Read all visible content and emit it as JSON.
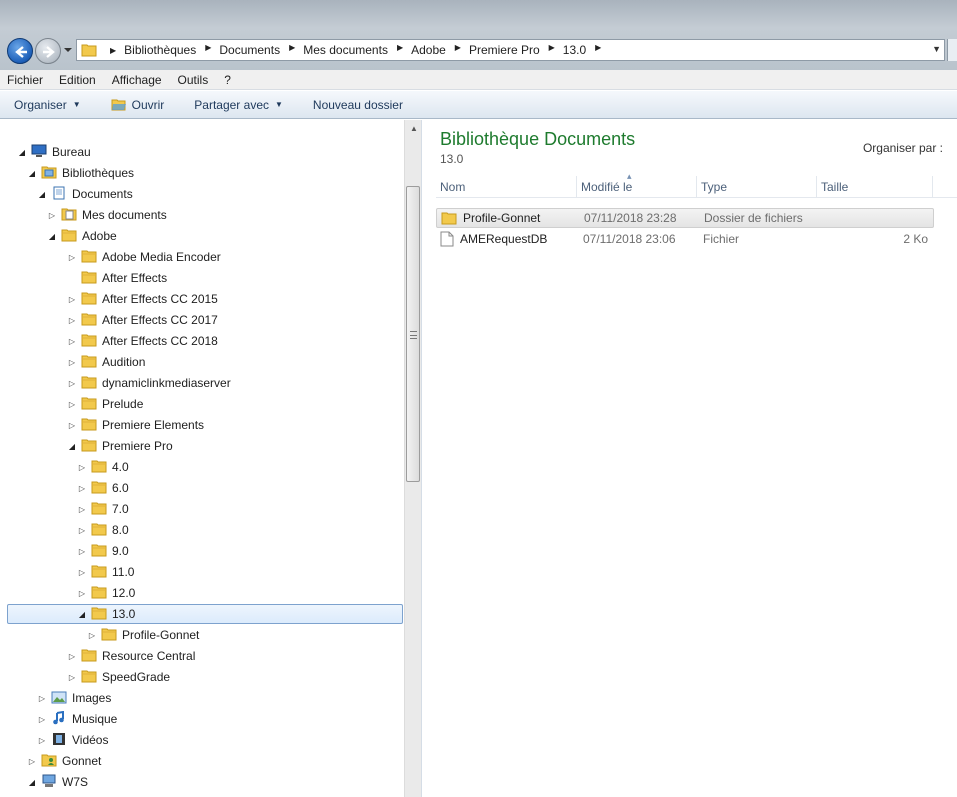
{
  "address": {
    "crumbs": [
      "Bibliothèques",
      "Documents",
      "Mes documents",
      "Adobe",
      "Premiere Pro",
      "13.0"
    ]
  },
  "menu": [
    "Fichier",
    "Edition",
    "Affichage",
    "Outils",
    "?"
  ],
  "commands": {
    "organize": "Organiser",
    "open": "Ouvrir",
    "share": "Partager avec",
    "new_folder": "Nouveau dossier"
  },
  "tree": [
    {
      "label": "Bureau",
      "level": 0,
      "expander": "open",
      "icon": "desktop"
    },
    {
      "label": "Bibliothèques",
      "level": 1,
      "expander": "open",
      "icon": "libraries"
    },
    {
      "label": "Documents",
      "level": 2,
      "expander": "open",
      "icon": "documents"
    },
    {
      "label": "Mes documents",
      "level": 3,
      "expander": "closed",
      "icon": "mydocs"
    },
    {
      "label": "Adobe",
      "level": 3,
      "expander": "open",
      "icon": "folder"
    },
    {
      "label": "Adobe Media Encoder",
      "level": 4,
      "expander": "closed",
      "icon": "folder"
    },
    {
      "label": "After Effects",
      "level": 4,
      "expander": "none",
      "icon": "folder"
    },
    {
      "label": "After Effects CC 2015",
      "level": 4,
      "expander": "closed",
      "icon": "folder"
    },
    {
      "label": "After Effects CC 2017",
      "level": 4,
      "expander": "closed",
      "icon": "folder"
    },
    {
      "label": "After Effects CC 2018",
      "level": 4,
      "expander": "closed",
      "icon": "folder"
    },
    {
      "label": "Audition",
      "level": 4,
      "expander": "closed",
      "icon": "folder"
    },
    {
      "label": "dynamiclinkmediaserver",
      "level": 4,
      "expander": "closed",
      "icon": "folder"
    },
    {
      "label": "Prelude",
      "level": 4,
      "expander": "closed",
      "icon": "folder"
    },
    {
      "label": "Premiere Elements",
      "level": 4,
      "expander": "closed",
      "icon": "folder"
    },
    {
      "label": "Premiere Pro",
      "level": 4,
      "expander": "open",
      "icon": "folder"
    },
    {
      "label": "4.0",
      "level": 5,
      "expander": "closed",
      "icon": "folder"
    },
    {
      "label": "6.0",
      "level": 5,
      "expander": "closed",
      "icon": "folder"
    },
    {
      "label": "7.0",
      "level": 5,
      "expander": "closed",
      "icon": "folder"
    },
    {
      "label": "8.0",
      "level": 5,
      "expander": "closed",
      "icon": "folder"
    },
    {
      "label": "9.0",
      "level": 5,
      "expander": "closed",
      "icon": "folder"
    },
    {
      "label": "11.0",
      "level": 5,
      "expander": "closed",
      "icon": "folder"
    },
    {
      "label": "12.0",
      "level": 5,
      "expander": "closed",
      "icon": "folder"
    },
    {
      "label": "13.0",
      "level": 5,
      "expander": "open",
      "icon": "folder",
      "selected": true
    },
    {
      "label": "Profile-Gonnet",
      "level": 6,
      "expander": "closed",
      "icon": "folder"
    },
    {
      "label": "Resource Central",
      "level": 4,
      "expander": "closed",
      "icon": "folder"
    },
    {
      "label": "SpeedGrade",
      "level": 4,
      "expander": "closed",
      "icon": "folder"
    },
    {
      "label": "Images",
      "level": 2,
      "expander": "closed",
      "icon": "images"
    },
    {
      "label": "Musique",
      "level": 2,
      "expander": "closed",
      "icon": "music"
    },
    {
      "label": "Vidéos",
      "level": 2,
      "expander": "closed",
      "icon": "videos"
    },
    {
      "label": "Gonnet",
      "level": 1,
      "expander": "closed",
      "icon": "user"
    },
    {
      "label": "W7S",
      "level": 1,
      "expander": "open",
      "icon": "computer"
    }
  ],
  "content": {
    "title": "Bibliothèque Documents",
    "subtitle": "13.0",
    "arrange_label": "Organiser par :",
    "columns": [
      "Nom",
      "Modifié le",
      "Type",
      "Taille"
    ],
    "rows": [
      {
        "name": "Profile-Gonnet",
        "date": "07/11/2018 23:28",
        "type": "Dossier de fichiers",
        "size": "",
        "icon": "folder"
      },
      {
        "name": "AMERequestDB",
        "date": "07/11/2018 23:06",
        "type": "Fichier",
        "size": "2 Ko",
        "icon": "file"
      }
    ]
  },
  "colors": {
    "title_green": "#1e7b2e",
    "selection_border": "#7da2ce",
    "folder_yellow": "#f2c94c"
  }
}
